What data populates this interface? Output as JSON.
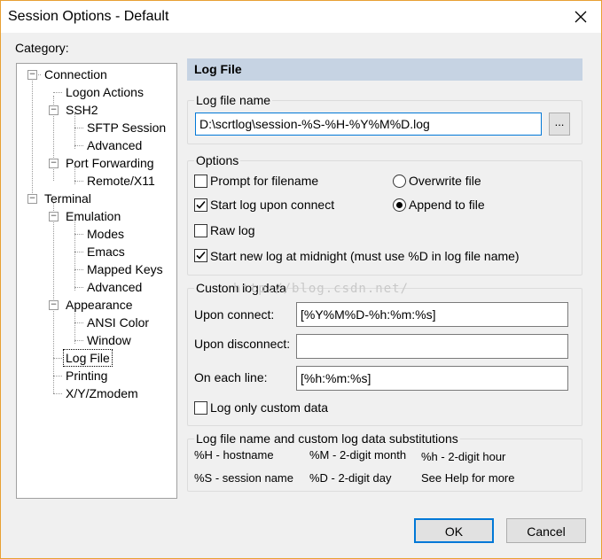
{
  "window": {
    "title": "Session Options - Default",
    "accent_color": "#e8a033",
    "header_color": "#c6d3e3"
  },
  "category": {
    "label": "Category:",
    "tree": [
      "Connection",
      "Logon Actions",
      "SSH2",
      "SFTP Session",
      "Advanced",
      "Port Forwarding",
      "Remote/X11",
      "Terminal",
      "Emulation",
      "Modes",
      "Emacs",
      "Mapped Keys",
      "Advanced",
      "Appearance",
      "ANSI Color",
      "Window",
      "Log File",
      "Printing",
      "X/Y/Zmodem"
    ],
    "selected": "Log File"
  },
  "panel": {
    "header": "Log File",
    "log_file_name": {
      "group_label": "Log file name",
      "value": "D:\\scrtlog\\session-%S-%H-%Y%M%D.log",
      "browse_label": "..."
    },
    "options": {
      "group_label": "Options",
      "prompt_filename": {
        "label": "Prompt for filename",
        "checked": false
      },
      "start_log_upon_connect": {
        "label": "Start log upon connect",
        "checked": true
      },
      "raw_log": {
        "label": "Raw log",
        "checked": false
      },
      "start_new_log_midnight": {
        "label": "Start new log at midnight (must use %D in log file name)",
        "checked": true
      },
      "overwrite_file": {
        "label": "Overwrite file",
        "selected": false
      },
      "append_to_file": {
        "label": "Append to file",
        "selected": true
      }
    },
    "custom": {
      "group_label": "Custom log data",
      "upon_connect_label": "Upon connect:",
      "upon_connect_value": "[%Y%M%D-%h:%m:%s]",
      "upon_disconnect_label": "Upon disconnect:",
      "upon_disconnect_value": "",
      "on_each_line_label": "On each line:",
      "on_each_line_value": "[%h:%m:%s]",
      "log_only_custom": {
        "label": "Log only custom data",
        "checked": false
      }
    },
    "substitutions": {
      "group_label": "Log file name and custom log data substitutions",
      "items": [
        "%H - hostname",
        "%M - 2-digit month",
        "%h - 2-digit hour",
        "%S - session name",
        "%D - 2-digit day",
        "See Help for more"
      ]
    }
  },
  "watermark": "http://blog.csdn.net/",
  "buttons": {
    "ok": "OK",
    "cancel": "Cancel"
  }
}
